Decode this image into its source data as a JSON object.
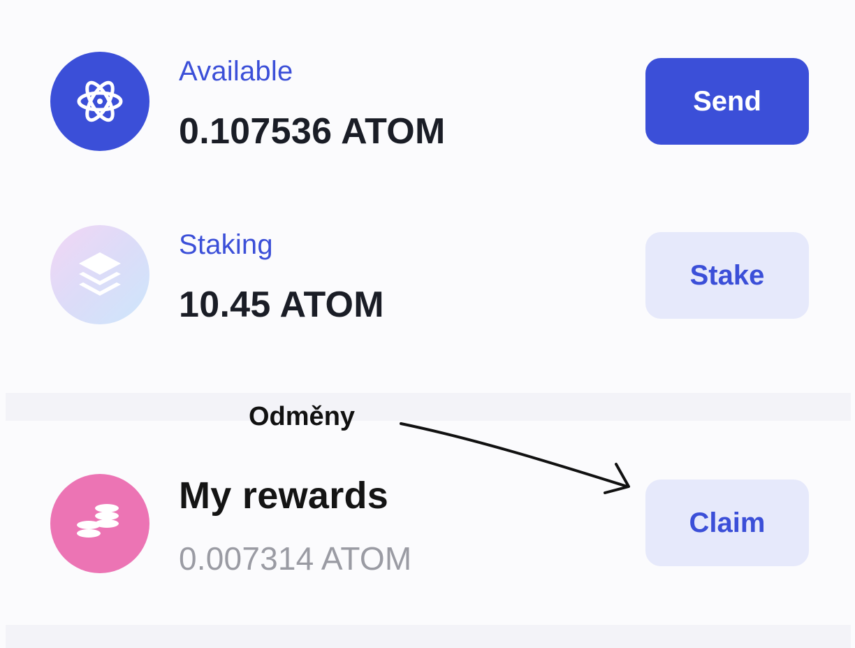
{
  "available": {
    "label": "Available",
    "amount": "0.107536 ATOM",
    "button": "Send",
    "icon": "atom-icon",
    "icon_bg": "#3b4fd8"
  },
  "staking": {
    "label": "Staking",
    "amount": "10.45 ATOM",
    "button": "Stake",
    "icon": "layers-icon"
  },
  "rewards": {
    "title": "My rewards",
    "amount": "0.007314 ATOM",
    "button": "Claim",
    "icon": "coins-icon",
    "icon_bg": "#ec74b4"
  },
  "annotation": {
    "text": "Odměny"
  },
  "colors": {
    "accent": "#3b4fd8",
    "secondary_button_bg": "#e6e9fb",
    "muted_text": "#9a9ba3"
  }
}
